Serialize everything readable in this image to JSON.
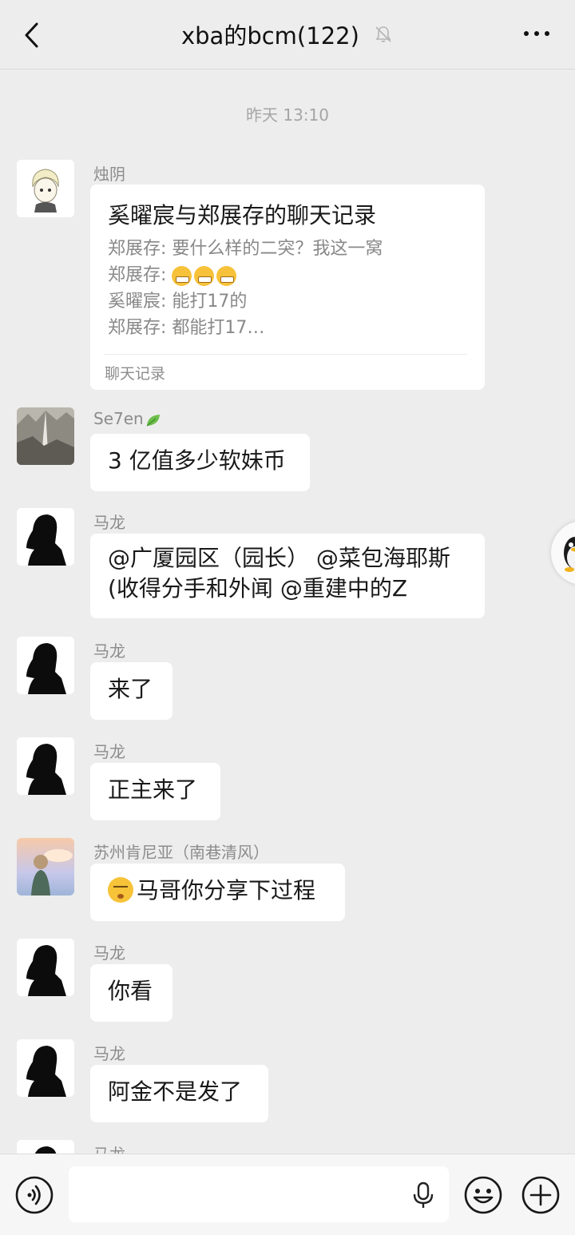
{
  "header": {
    "title": "xba的bcm(122)"
  },
  "timestamp": "昨天 13:10",
  "messages": [
    {
      "sender": "烛阴",
      "card": {
        "title": "奚曜宸与郑展存的聊天记录",
        "lines": [
          "郑展存: 要什么样的二突？我这一窝",
          "郑展存: ",
          "奚曜宸: 能打17的",
          "郑展存: 都能打17…"
        ],
        "emoji_count": 3,
        "footer": "聊天记录"
      }
    },
    {
      "sender": "Se7en",
      "text": "3 亿值多少软妹币"
    },
    {
      "sender": "马龙",
      "lines": [
        "@广厦园区（园长） @菜包海耶斯",
        "(收得分手和外闻  @重建中的Z"
      ]
    },
    {
      "sender": "马龙",
      "text": "来了"
    },
    {
      "sender": "马龙",
      "text": "正主来了"
    },
    {
      "sender": "苏州肯尼亚（南巷清风）",
      "text": "马哥你分享下过程"
    },
    {
      "sender": "马龙",
      "text": "你看"
    },
    {
      "sender": "马龙",
      "text": "阿金不是发了"
    },
    {
      "sender": "马龙"
    }
  ]
}
